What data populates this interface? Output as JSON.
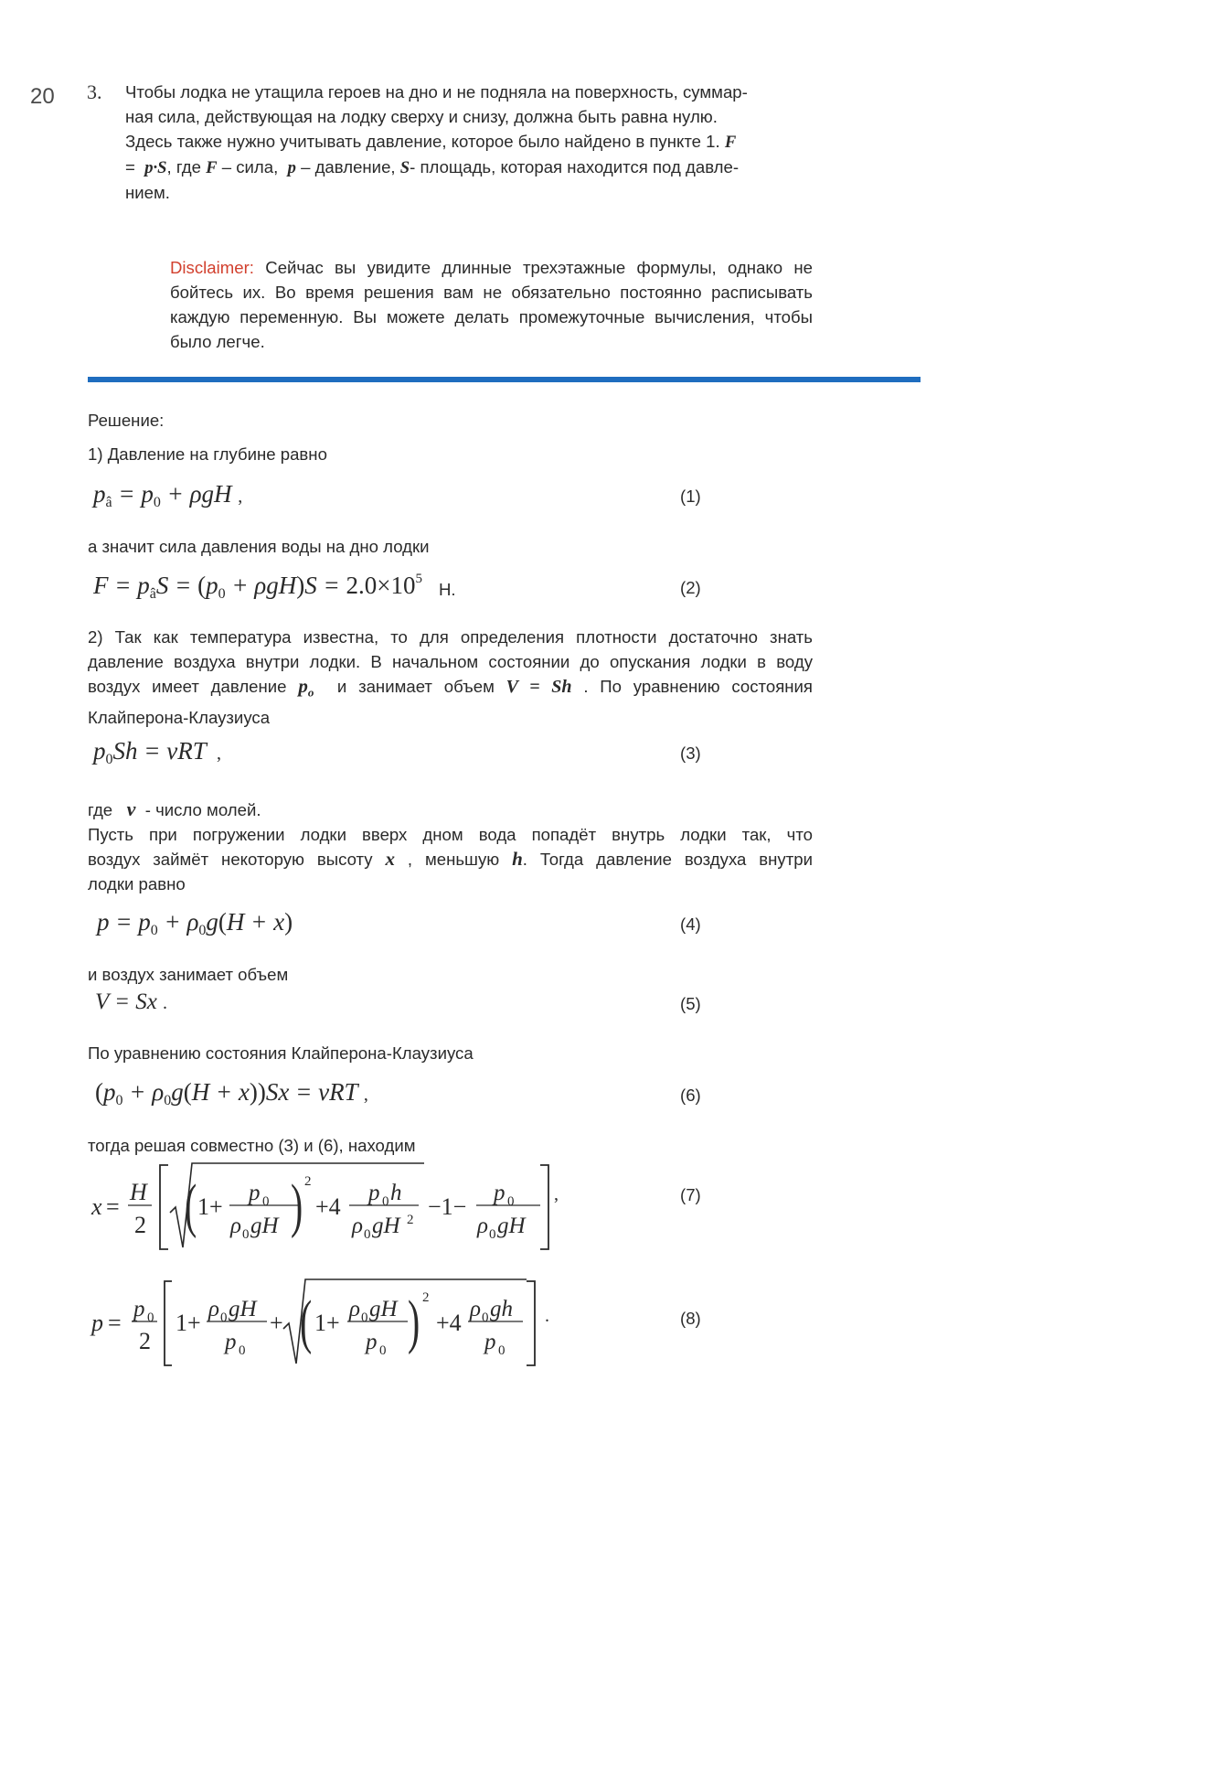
{
  "page_number": "20",
  "item_number": "3.",
  "problem": {
    "line1": "Чтобы лодка не утащила героев на дно и не подняла на поверхность, суммар-",
    "line2": "ная сила, действующая на лодку сверху и снизу, должна быть равна нулю.",
    "line3": "Здесь также нужно учитывать давление, которое было найдено в пункте 1.",
    "line3_sym": "F",
    "line4_a": "=",
    "line4_b": "p·S",
    "line4_c": ", где",
    "line4_d": "F",
    "line4_e": "– сила,",
    "line4_f": "p",
    "line4_g": "– давление,",
    "line4_h": "S",
    "line4_i": "- площадь, которая находится под давле-",
    "line5": "нием."
  },
  "disclaimer": {
    "label": "Disclaimer:",
    "text": "Сейчас вы увидите длинные трехэтажные формулы, однако не бойтесь их. Во время решения вам не обязательно постоянно расписывать каждую переменную. Вы можете делать промежуточные вычисления, чтобы было легче."
  },
  "solution": {
    "heading": "Решение:",
    "step1": "1) Давление на глубине   равно",
    "after_eq1": "а значит сила давления воды на дно лодки",
    "unit_N": "Н.",
    "step2_l1": "2) Так как температура известна, то для определения плотности достаточно знать",
    "step2_l2": "давление воздуха внутри лодки. В начальном состоянии до опускания лодки в воду",
    "step2_l3a": "воздух имеет давление",
    "step2_l3_p": "p",
    "step2_l3_psub": "o",
    "step2_l3b": "и занимает объем",
    "step2_l3_V": "V = Sh",
    "step2_l3c": ". По уравнению состояния",
    "step2_l4": "Клайперона-Клаузиуса",
    "where_a": "где",
    "where_nu": "ν",
    "where_b": "- число молей.",
    "p_l1": "Пусть при погружении лодки вверх дном вода попадёт внутрь лодки так, что",
    "p_l2a": "воздух займёт некоторую высоту",
    "p_l2_x": "x",
    "p_l2b": ", меньшую",
    "p_l2_h": "h",
    "p_l2c": ". Тогда давление воздуха внутри",
    "p_l3": "лодки равно",
    "air_volume": "и воздух занимает объем",
    "by_eq": "По уравнению состояния Клайперона-Клаузиуса",
    "then": "тогда решая совместно (3) и (6), находим"
  },
  "equation_numbers": [
    "(1)",
    "(2)",
    "(3)",
    "(4)",
    "(5)",
    "(6)",
    "(7)",
    "(8)"
  ],
  "equations": {
    "eq2_value": "2.0×10",
    "eq2_exp": "5"
  },
  "colors": {
    "rule": "#1f6dbf",
    "disclaimer_label": "#d2402e",
    "text": "#2a2a2a"
  }
}
